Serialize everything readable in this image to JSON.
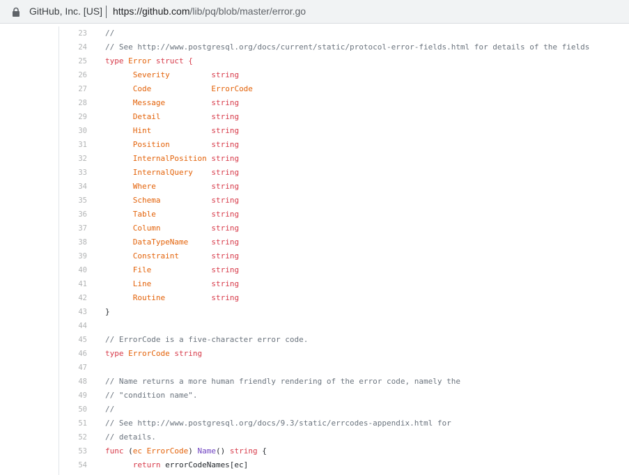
{
  "browser": {
    "site_identity": "GitHub, Inc. [US]",
    "url_host": "https://github.com",
    "url_path": "/lib/pq/blob/master/error.go"
  },
  "code_lines": [
    {
      "n": "23",
      "parts": [
        {
          "t": "//",
          "c": "c"
        }
      ]
    },
    {
      "n": "24",
      "parts": [
        {
          "t": "// See http://www.postgresql.org/docs/current/static/protocol-error-fields.html for details of the fields",
          "c": "c"
        }
      ]
    },
    {
      "n": "25",
      "parts": [
        {
          "t": "type ",
          "c": "k"
        },
        {
          "t": "Error",
          "c": "t"
        },
        {
          "t": " struct {",
          "c": "k"
        }
      ]
    },
    {
      "n": "26",
      "parts": [
        {
          "t": "\tSeverity         ",
          "c": "t"
        },
        {
          "t": "string",
          "c": "k"
        }
      ]
    },
    {
      "n": "27",
      "parts": [
        {
          "t": "\tCode             ",
          "c": "t"
        },
        {
          "t": "ErrorCode",
          "c": "t"
        }
      ]
    },
    {
      "n": "28",
      "parts": [
        {
          "t": "\tMessage          ",
          "c": "t"
        },
        {
          "t": "string",
          "c": "k"
        }
      ]
    },
    {
      "n": "29",
      "parts": [
        {
          "t": "\tDetail           ",
          "c": "t"
        },
        {
          "t": "string",
          "c": "k"
        }
      ]
    },
    {
      "n": "30",
      "parts": [
        {
          "t": "\tHint             ",
          "c": "t"
        },
        {
          "t": "string",
          "c": "k"
        }
      ]
    },
    {
      "n": "31",
      "parts": [
        {
          "t": "\tPosition         ",
          "c": "t"
        },
        {
          "t": "string",
          "c": "k"
        }
      ]
    },
    {
      "n": "32",
      "parts": [
        {
          "t": "\tInternalPosition ",
          "c": "t"
        },
        {
          "t": "string",
          "c": "k"
        }
      ]
    },
    {
      "n": "33",
      "parts": [
        {
          "t": "\tInternalQuery    ",
          "c": "t"
        },
        {
          "t": "string",
          "c": "k"
        }
      ]
    },
    {
      "n": "34",
      "parts": [
        {
          "t": "\tWhere            ",
          "c": "t"
        },
        {
          "t": "string",
          "c": "k"
        }
      ]
    },
    {
      "n": "35",
      "parts": [
        {
          "t": "\tSchema           ",
          "c": "t"
        },
        {
          "t": "string",
          "c": "k"
        }
      ]
    },
    {
      "n": "36",
      "parts": [
        {
          "t": "\tTable            ",
          "c": "t"
        },
        {
          "t": "string",
          "c": "k"
        }
      ]
    },
    {
      "n": "37",
      "parts": [
        {
          "t": "\tColumn           ",
          "c": "t"
        },
        {
          "t": "string",
          "c": "k"
        }
      ]
    },
    {
      "n": "38",
      "parts": [
        {
          "t": "\tDataTypeName     ",
          "c": "t"
        },
        {
          "t": "string",
          "c": "k"
        }
      ]
    },
    {
      "n": "39",
      "parts": [
        {
          "t": "\tConstraint       ",
          "c": "t"
        },
        {
          "t": "string",
          "c": "k"
        }
      ]
    },
    {
      "n": "40",
      "parts": [
        {
          "t": "\tFile             ",
          "c": "t"
        },
        {
          "t": "string",
          "c": "k"
        }
      ]
    },
    {
      "n": "41",
      "parts": [
        {
          "t": "\tLine             ",
          "c": "t"
        },
        {
          "t": "string",
          "c": "k"
        }
      ]
    },
    {
      "n": "42",
      "parts": [
        {
          "t": "\tRoutine          ",
          "c": "t"
        },
        {
          "t": "string",
          "c": "k"
        }
      ]
    },
    {
      "n": "43",
      "parts": [
        {
          "t": "}",
          "c": ""
        }
      ]
    },
    {
      "n": "44",
      "parts": []
    },
    {
      "n": "45",
      "parts": [
        {
          "t": "// ErrorCode is a five-character error code.",
          "c": "c"
        }
      ]
    },
    {
      "n": "46",
      "parts": [
        {
          "t": "type ",
          "c": "k"
        },
        {
          "t": "ErrorCode",
          "c": "t"
        },
        {
          "t": " string",
          "c": "k"
        }
      ]
    },
    {
      "n": "47",
      "parts": []
    },
    {
      "n": "48",
      "parts": [
        {
          "t": "// Name returns a more human friendly rendering of the error code, namely the",
          "c": "c"
        }
      ]
    },
    {
      "n": "49",
      "parts": [
        {
          "t": "// \"condition name\".",
          "c": "c"
        }
      ]
    },
    {
      "n": "50",
      "parts": [
        {
          "t": "//",
          "c": "c"
        }
      ]
    },
    {
      "n": "51",
      "parts": [
        {
          "t": "// See http://www.postgresql.org/docs/9.3/static/errcodes-appendix.html for",
          "c": "c"
        }
      ]
    },
    {
      "n": "52",
      "parts": [
        {
          "t": "// details.",
          "c": "c"
        }
      ]
    },
    {
      "n": "53",
      "parts": [
        {
          "t": "func ",
          "c": "k"
        },
        {
          "t": "(",
          "c": ""
        },
        {
          "t": "ec ",
          "c": "t"
        },
        {
          "t": "ErrorCode",
          "c": "t"
        },
        {
          "t": ") ",
          "c": ""
        },
        {
          "t": "Name",
          "c": "f"
        },
        {
          "t": "() ",
          "c": ""
        },
        {
          "t": "string",
          "c": "k"
        },
        {
          "t": " {",
          "c": ""
        }
      ]
    },
    {
      "n": "54",
      "parts": [
        {
          "t": "\treturn ",
          "c": "k"
        },
        {
          "t": "errorCodeNames[ec]",
          "c": ""
        }
      ]
    }
  ]
}
